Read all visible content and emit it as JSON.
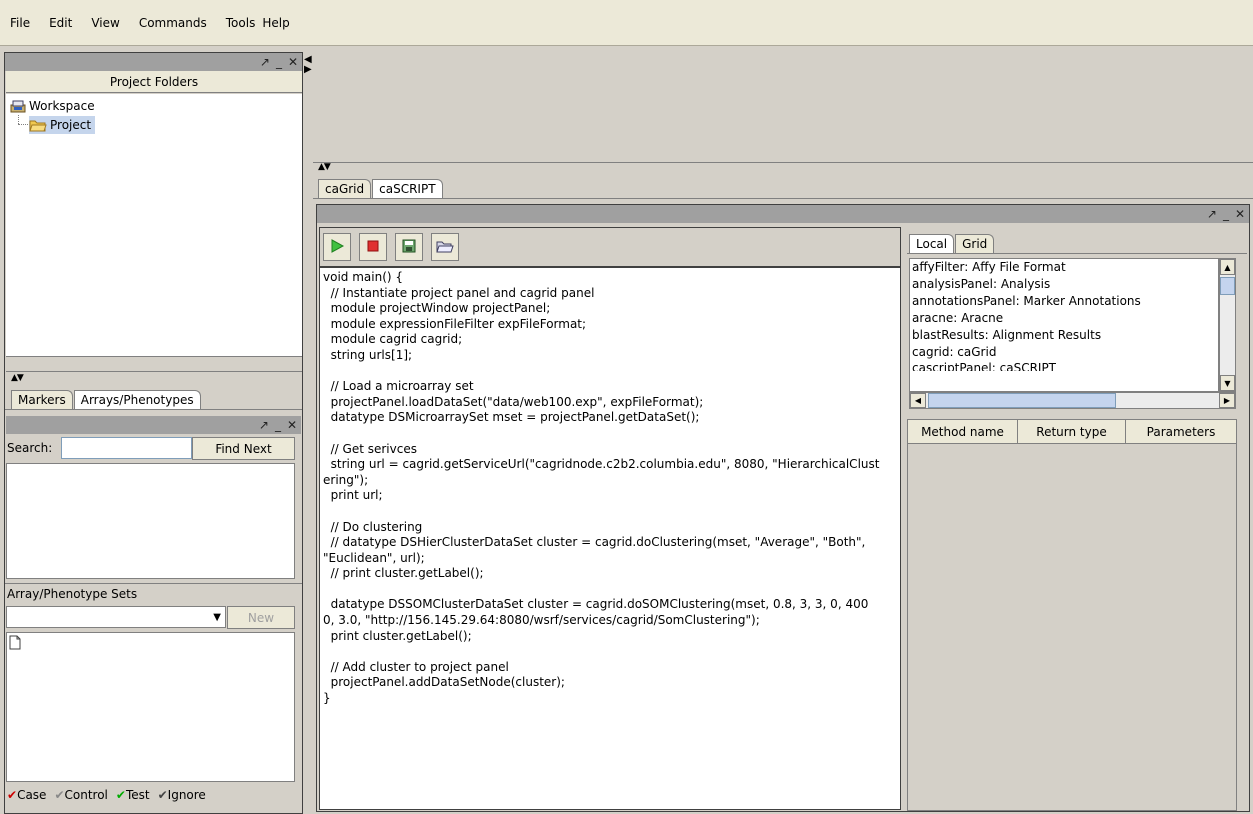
{
  "menu": [
    "File",
    "Edit",
    "View",
    "Commands",
    "Tools",
    "Help"
  ],
  "project_panel": {
    "title": "Project Folders",
    "tree": [
      {
        "label": "Workspace",
        "icon": "workspace-icon"
      },
      {
        "label": "Project",
        "icon": "folder-open-icon"
      }
    ]
  },
  "lower_left": {
    "tabs": [
      "Markers",
      "Arrays/Phenotypes"
    ],
    "search_label": "Search:",
    "search_value": "",
    "find_next": "Find Next",
    "sets_label": "Array/Phenotype Sets",
    "new_button": "New",
    "legend": [
      "Case",
      "Control",
      "Test",
      "Ignore"
    ],
    "legend_colors": [
      "#cc0000",
      "#888888",
      "#00aa00",
      "#444444"
    ]
  },
  "main_tabs": [
    "caGrid",
    "caSCRIPT"
  ],
  "script": {
    "toolbar": [
      "run-icon",
      "stop-icon",
      "save-icon",
      "open-icon"
    ],
    "code": "void main() {\n  // Instantiate project panel and cagrid panel\n  module projectWindow projectPanel;\n  module expressionFileFilter expFileFormat;\n  module cagrid cagrid;\n  string urls[1];\n\n  // Load a microarray set\n  projectPanel.loadDataSet(\"data/web100.exp\", expFileFormat);\n  datatype DSMicroarraySet mset = projectPanel.getDataSet();\n\n  // Get serivces\n  string url = cagrid.getServiceUrl(\"cagridnode.c2b2.columbia.edu\", 8080, \"HierarchicalClust\nering\");\n  print url;\n\n  // Do clustering\n  // datatype DSHierClusterDataSet cluster = cagrid.doClustering(mset, \"Average\", \"Both\",\n\"Euclidean\", url);\n  // print cluster.getLabel();\n\n  datatype DSSOMClusterDataSet cluster = cagrid.doSOMClustering(mset, 0.8, 3, 3, 0, 400\n0, 3.0, \"http://156.145.29.64:8080/wsrf/services/cagrid/SomClustering\");\n  print cluster.getLabel();\n\n  // Add cluster to project panel\n  projectPanel.addDataSetNode(cluster);\n}"
  },
  "right_panel": {
    "tabs": [
      "Local",
      "Grid"
    ],
    "items": [
      "affyFilter: Affy File Format",
      "analysisPanel: Analysis",
      "annotationsPanel: Marker Annotations",
      "aracne: Aracne",
      "blastResults: Alignment Results",
      "cagrid: caGrid",
      "cascriptPanel: caSCRIPT"
    ],
    "columns": [
      "Method name",
      "Return type",
      "Parameters"
    ]
  }
}
